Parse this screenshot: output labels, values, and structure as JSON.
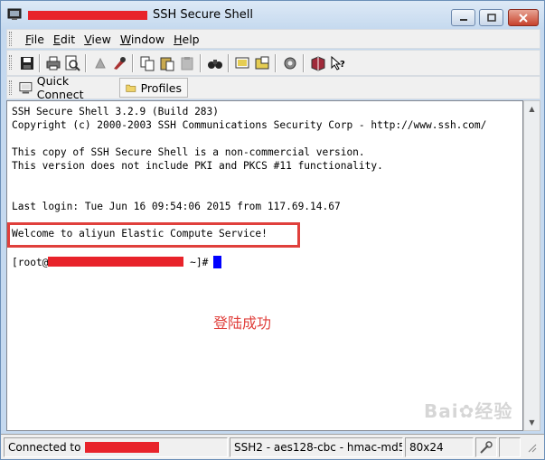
{
  "window": {
    "title": "SSH Secure Shell"
  },
  "menu": [
    {
      "label": "File",
      "mnemonic": "F",
      "rest": "ile"
    },
    {
      "label": "Edit",
      "mnemonic": "E",
      "rest": "dit"
    },
    {
      "label": "View",
      "mnemonic": "V",
      "rest": "iew"
    },
    {
      "label": "Window",
      "mnemonic": "W",
      "rest": "indow"
    },
    {
      "label": "Help",
      "mnemonic": "H",
      "rest": "elp"
    }
  ],
  "toolbar_icons": [
    "save-icon",
    "print-icon",
    "print-preview-icon",
    "disconnect-icon",
    "settings-icon",
    "copy-icon",
    "paste-icon",
    "paste-disabled-icon",
    "find-icon",
    "new-terminal-icon",
    "new-file-transfer-icon",
    "gear-icon",
    "book-icon",
    "context-help-icon"
  ],
  "shortcuts": {
    "quick_connect": "Quick Connect",
    "profiles": "Profiles"
  },
  "terminal": {
    "lines": [
      "SSH Secure Shell 3.2.9 (Build 283)",
      "Copyright (c) 2000-2003 SSH Communications Security Corp - http://www.ssh.com/",
      "",
      "This copy of SSH Secure Shell is a non-commercial version.",
      "This version does not include PKI and PKCS #11 functionality.",
      "",
      "",
      "Last login: Tue Jun 16 09:54:06 2015 from 117.69.14.67",
      "",
      "Welcome to aliyun Elastic Compute Service!",
      ""
    ],
    "prompt_prefix": "[root@",
    "prompt_suffix": " ~]#",
    "annotation": "登陆成功"
  },
  "status": {
    "connected_label": "Connected to",
    "cipher": "SSH2 - aes128-cbc - hmac-md5",
    "size": "80x24"
  },
  "colors": {
    "redaction": "#e8232a",
    "highlight_box": "#e0403c",
    "cursor": "#0000ff"
  }
}
